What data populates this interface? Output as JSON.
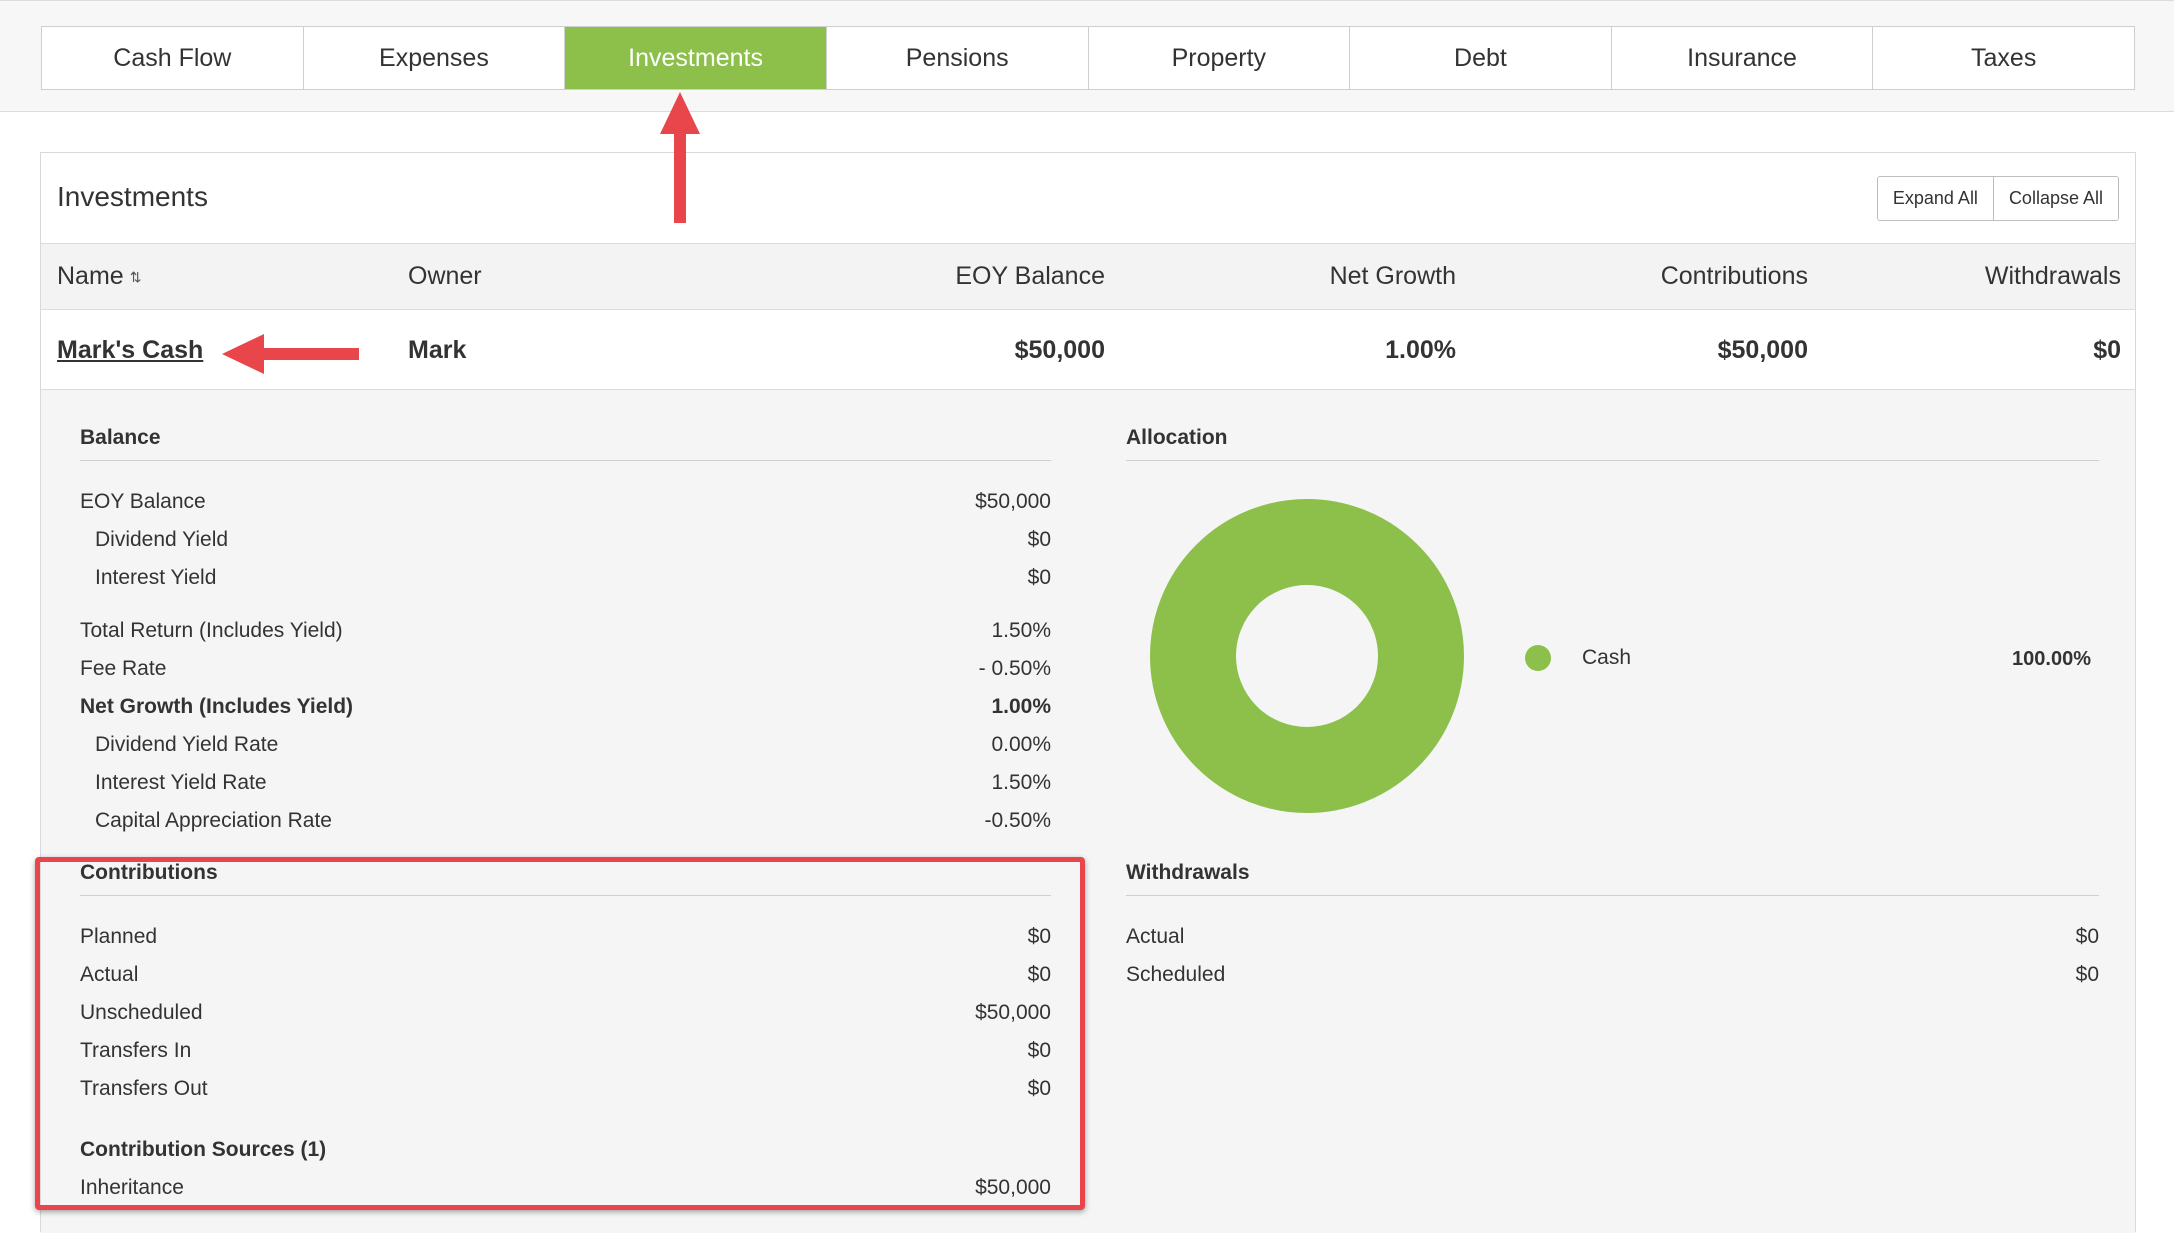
{
  "tabs": [
    {
      "label": "Cash Flow"
    },
    {
      "label": "Expenses"
    },
    {
      "label": "Investments"
    },
    {
      "label": "Pensions"
    },
    {
      "label": "Property"
    },
    {
      "label": "Debt"
    },
    {
      "label": "Insurance"
    },
    {
      "label": "Taxes"
    }
  ],
  "active_tab": "Investments",
  "panel": {
    "title": "Investments",
    "expand_all": "Expand All",
    "collapse_all": "Collapse All"
  },
  "table": {
    "columns": {
      "name": "Name",
      "owner": "Owner",
      "eoy_balance": "EOY Balance",
      "net_growth": "Net Growth",
      "contributions": "Contributions",
      "withdrawals": "Withdrawals"
    },
    "row": {
      "name": "Mark's Cash",
      "owner": "Mark",
      "eoy_balance": "$50,000",
      "net_growth": "1.00%",
      "contributions": "$50,000",
      "withdrawals": "$0"
    }
  },
  "balance": {
    "title": "Balance",
    "eoy_balance": {
      "label": "EOY Balance",
      "value": "$50,000"
    },
    "dividend_yield": {
      "label": "Dividend Yield",
      "value": "$0"
    },
    "interest_yield": {
      "label": "Interest Yield",
      "value": "$0"
    },
    "total_return": {
      "label": "Total Return (Includes Yield)",
      "value": "1.50%"
    },
    "fee_rate": {
      "label": "Fee Rate",
      "value": "- 0.50%"
    },
    "net_growth": {
      "label": "Net Growth (Includes Yield)",
      "value": "1.00%"
    },
    "dividend_yield_rate": {
      "label": "Dividend Yield Rate",
      "value": "0.00%"
    },
    "interest_yield_rate": {
      "label": "Interest Yield Rate",
      "value": "1.50%"
    },
    "capital_appreciation_rate": {
      "label": "Capital Appreciation Rate",
      "value": "-0.50%"
    }
  },
  "allocation": {
    "title": "Allocation",
    "items": [
      {
        "label": "Cash",
        "value": "100.00%",
        "fraction": 1.0,
        "color": "#8cc04b"
      }
    ]
  },
  "contributions": {
    "title": "Contributions",
    "planned": {
      "label": "Planned",
      "value": "$0"
    },
    "actual": {
      "label": "Actual",
      "value": "$0"
    },
    "unscheduled": {
      "label": "Unscheduled",
      "value": "$50,000"
    },
    "transfers_in": {
      "label": "Transfers In",
      "value": "$0"
    },
    "transfers_out": {
      "label": "Transfers Out",
      "value": "$0"
    },
    "sources_title": "Contribution Sources (1)",
    "inheritance": {
      "label": "Inheritance",
      "value": "$50,000"
    }
  },
  "withdrawals": {
    "title": "Withdrawals",
    "actual": {
      "label": "Actual",
      "value": "$0"
    },
    "scheduled": {
      "label": "Scheduled",
      "value": "$0"
    }
  },
  "colors": {
    "accent": "#8cc04b",
    "annotation": "#e8464b"
  }
}
